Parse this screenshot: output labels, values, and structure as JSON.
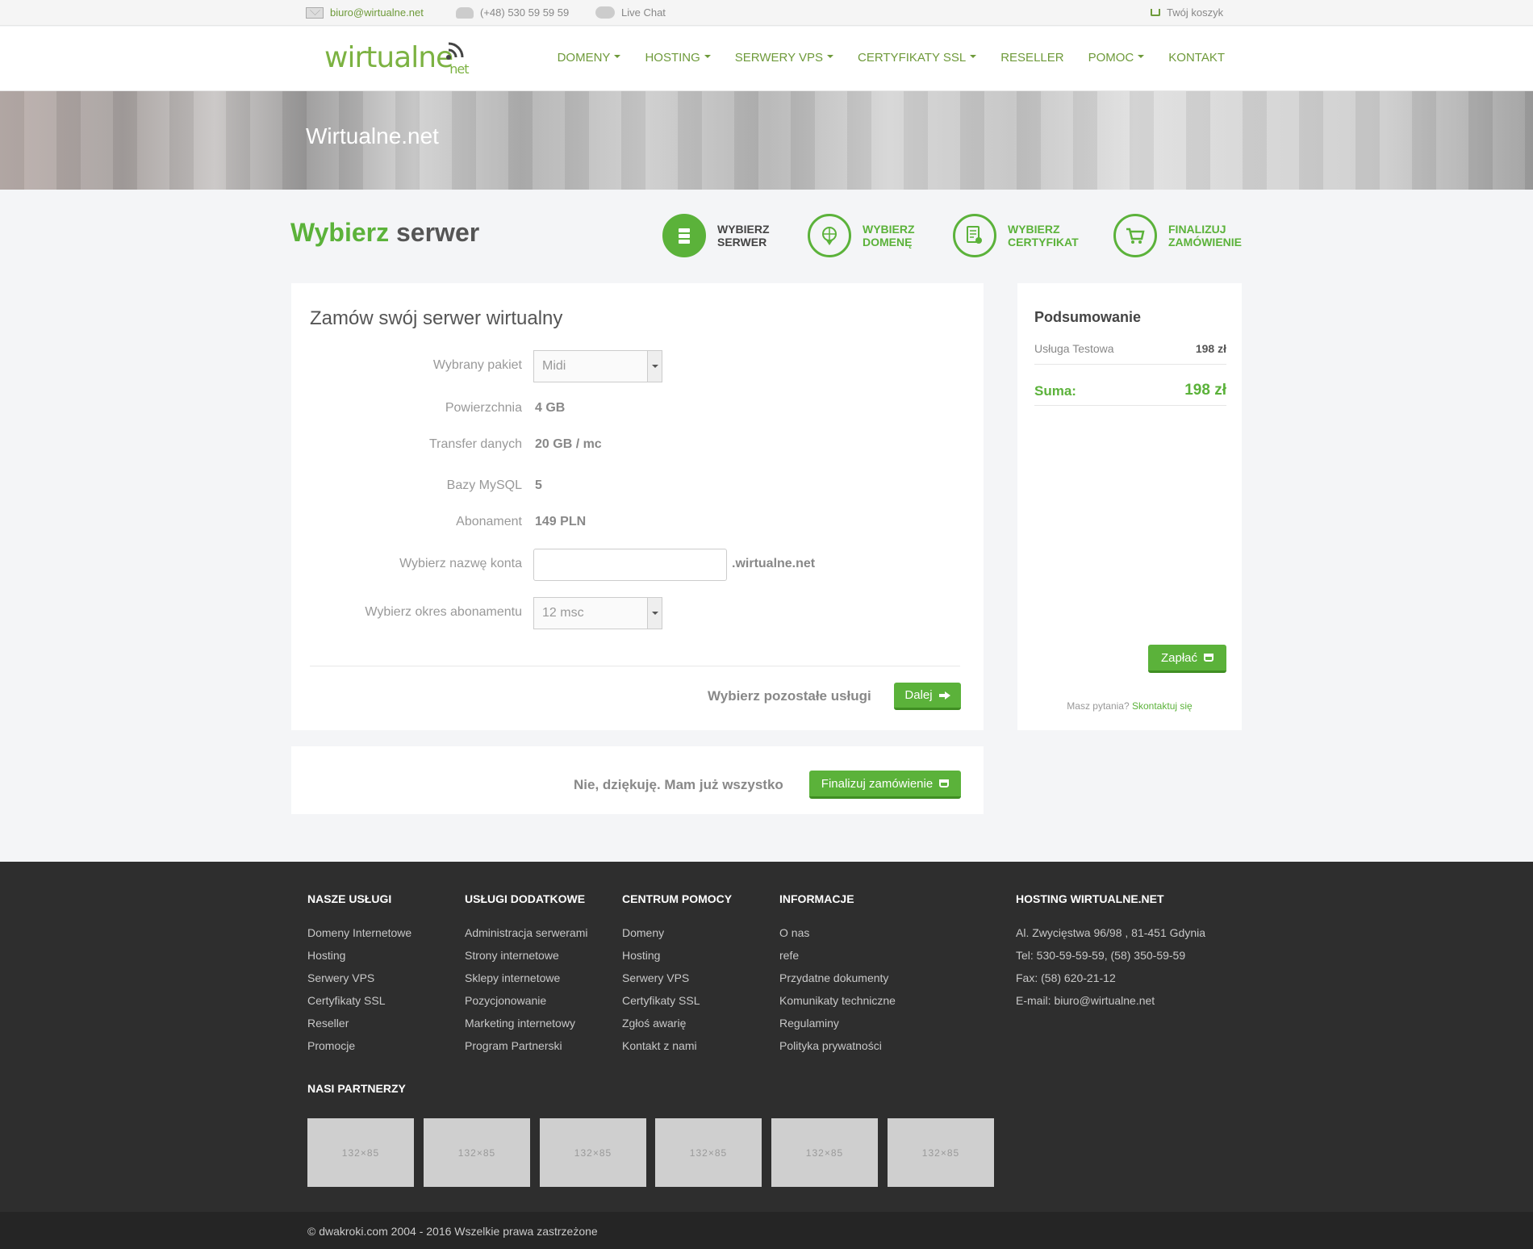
{
  "topbar": {
    "email": "biuro@wirtualne.net",
    "phone": "(+48) 530 59 59 59",
    "chat": "Live Chat",
    "cart": "Twój koszyk"
  },
  "header": {
    "logo_main": "wirtualne",
    "logo_sub": "net",
    "nav": [
      {
        "label": "DOMENY",
        "dropdown": true
      },
      {
        "label": "HOSTING",
        "dropdown": true
      },
      {
        "label": "SERWERY VPS",
        "dropdown": true
      },
      {
        "label": "CERTYFIKATY SSL",
        "dropdown": true
      },
      {
        "label": "RESELLER",
        "dropdown": false
      },
      {
        "label": "POMOC",
        "dropdown": true
      },
      {
        "label": "KONTAKT",
        "dropdown": false
      }
    ]
  },
  "hero": {
    "title": "Wirtualne.net"
  },
  "page_title": {
    "green": "Wybierz",
    "dark": "serwer"
  },
  "steps": [
    {
      "line1": "WYBIERZ",
      "line2": "SERWER",
      "icon": "server-icon",
      "active": true
    },
    {
      "line1": "WYBIERZ",
      "line2": "DOMENĘ",
      "icon": "globe-pin-icon",
      "active": false
    },
    {
      "line1": "WYBIERZ",
      "line2": "CERTYFIKAT",
      "icon": "certificate-icon",
      "active": false
    },
    {
      "line1": "FINALIZUJ",
      "line2": "ZAMÓWIENIE",
      "icon": "cart-icon",
      "active": false
    }
  ],
  "form": {
    "title": "Zamów swój serwer wirtualny",
    "package_label": "Wybrany pakiet",
    "package_value": "Midi",
    "space_label": "Powierzchnia",
    "space_value": "4 GB",
    "transfer_label": "Transfer danych",
    "transfer_value": "20 GB / mc",
    "mysql_label": "Bazy MySQL",
    "mysql_value": "5",
    "sub_label": "Abonament",
    "sub_value": "149 PLN",
    "account_label": "Wybierz nazwę konta",
    "account_value": "",
    "account_suffix": ".wirtualne.net",
    "period_label": "Wybierz okres abonamentu",
    "period_value": "12 msc",
    "next_text": "Wybierz pozostałe usługi",
    "next_button": "Dalej"
  },
  "finalize": {
    "text": "Nie, dziękuję. Mam już wszystko",
    "button": "Finalizuj zamówienie"
  },
  "summary": {
    "title": "Podsumowanie",
    "item_name": "Usługa Testowa",
    "item_price": "198 zł",
    "total_label": "Suma:",
    "total_price": "198 zł",
    "pay_button": "Zapłać",
    "question": "Masz pytania?",
    "contact_link": "Skontaktuj się"
  },
  "footer": {
    "cols": [
      {
        "title": "NASZE USŁUGI",
        "items": [
          "Domeny Internetowe",
          "Hosting",
          "Serwery VPS",
          "Certyfikaty SSL",
          "Reseller",
          "Promocje"
        ]
      },
      {
        "title": "USŁUGI DODATKOWE",
        "items": [
          "Administracja serwerami",
          "Strony internetowe",
          "Sklepy internetowe",
          "Pozycjonowanie",
          "Marketing internetowy",
          "Program Partnerski"
        ]
      },
      {
        "title": "CENTRUM POMOCY",
        "items": [
          "Domeny",
          "Hosting",
          "Serwery VPS",
          "Certyfikaty SSL",
          "Zgłoś awarię",
          "Kontakt z nami"
        ]
      },
      {
        "title": "INFORMACJE",
        "items": [
          "O nas",
          "refe",
          "Przydatne dokumenty",
          "Komunikaty techniczne",
          "Regulaminy",
          "Polityka prywatności"
        ]
      },
      {
        "title": "HOSTING WIRTUALNE.NET",
        "items": [
          "Al. Zwycięstwa 96/98 , 81-451 Gdynia",
          "Tel: 530-59-59-59, (58) 350-59-59",
          "Fax: (58) 620-21-12",
          "E-mail: biuro@wirtualne.net"
        ]
      }
    ],
    "partners_title": "NASI PARTNERZY",
    "partner_placeholder": "132×85",
    "copyright": "© dwakroki.com 2004 - 2016 Wszelkie prawa zastrzeżone"
  }
}
